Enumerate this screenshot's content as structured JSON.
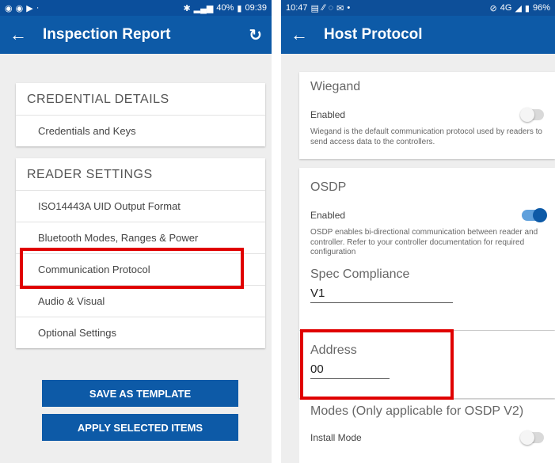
{
  "left_screen": {
    "status": {
      "battery": "40%",
      "time": "09:39"
    },
    "title": "Inspection Report",
    "credential_section": {
      "header": "CREDENTIAL DETAILS",
      "items": [
        "Credentials and Keys"
      ]
    },
    "reader_section": {
      "header": "READER SETTINGS",
      "items": [
        "ISO14443A UID Output Format",
        "Bluetooth Modes, Ranges & Power",
        "Communication Protocol",
        "Audio & Visual",
        "Optional Settings"
      ]
    },
    "buttons": {
      "save": "SAVE AS TEMPLATE",
      "apply": "APPLY SELECTED ITEMS"
    }
  },
  "right_screen": {
    "status": {
      "time": "10:47",
      "network": "4G",
      "battery": "96%"
    },
    "title": "Host Protocol",
    "wiegand": {
      "header": "Wiegand",
      "enabled_label": "Enabled",
      "enabled": false,
      "description": "Wiegand is the default communication protocol used by readers to send access data to the controllers."
    },
    "osdp": {
      "header": "OSDP",
      "enabled_label": "Enabled",
      "enabled": true,
      "description": "OSDP enables bi-directional communication between reader and controller. Refer to your controller documentation for required configuration",
      "spec_label": "Spec Compliance",
      "spec_value": "V1",
      "address_label": "Address",
      "address_value": "00"
    },
    "modes": {
      "header": "Modes (Only applicable for OSDP V2)",
      "install_label": "Install Mode",
      "install_enabled": false
    }
  },
  "colors": {
    "appbar": "#0d5aa7",
    "statusbar": "#0b4f9c",
    "highlight": "#e00000",
    "toggle_on": "#0d5aa7"
  }
}
